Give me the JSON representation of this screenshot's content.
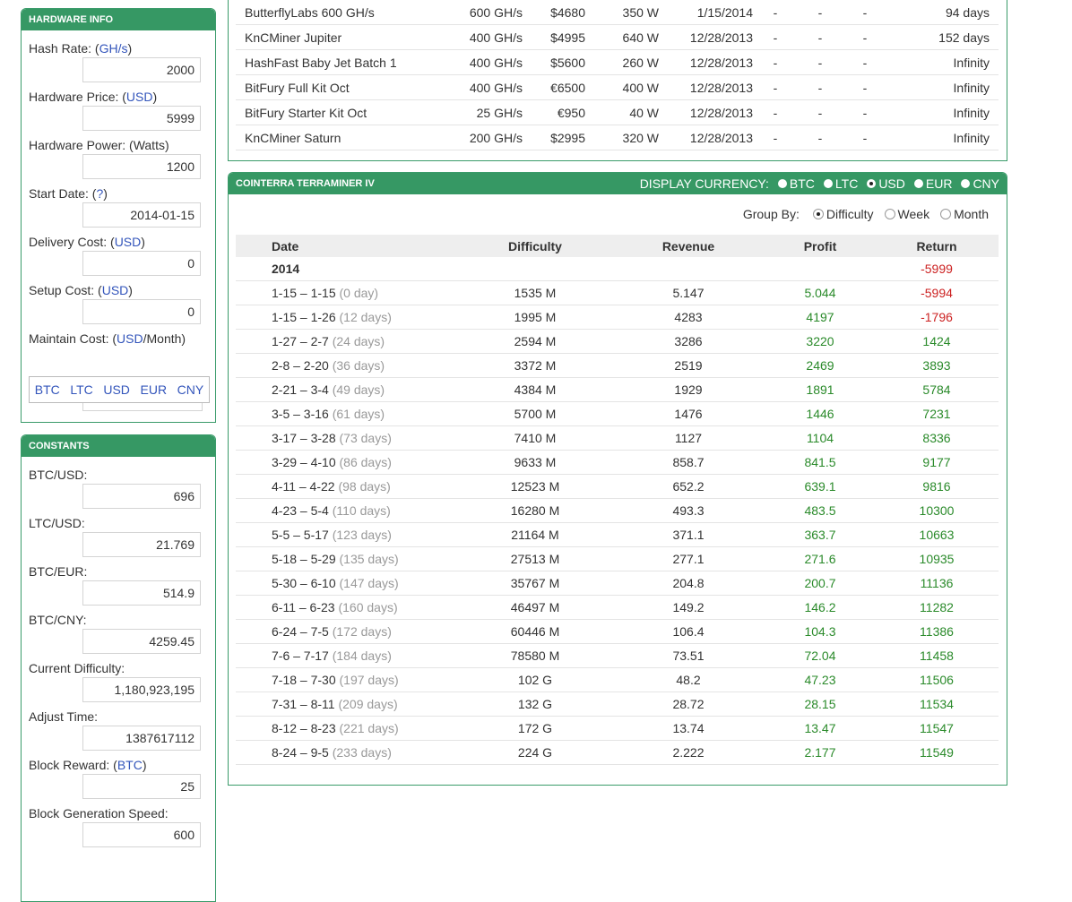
{
  "hardware": {
    "title": "HARDWARE INFO",
    "fields": [
      {
        "label": "Hash Rate: (",
        "link": "GH/s",
        "suffix": ")",
        "value": "2000"
      },
      {
        "label": "Hardware Price: (",
        "link": "USD",
        "suffix": ")",
        "value": "5999"
      },
      {
        "label": "Hardware Power: (Watts)",
        "link": "",
        "suffix": "",
        "value": "1200"
      },
      {
        "label": "Start Date: (",
        "link": "?",
        "suffix": ")",
        "value": "2014-01-15"
      },
      {
        "label": "Delivery Cost: (",
        "link": "USD",
        "suffix": ")",
        "value": "0"
      },
      {
        "label": "Setup Cost: (",
        "link": "USD",
        "suffix": ")",
        "value": "0"
      },
      {
        "label": "Maintain Cost: (",
        "link": "USD",
        "suffix": "/Month)",
        "value": ""
      }
    ],
    "currency_popup": [
      "BTC",
      "LTC",
      "USD",
      "EUR",
      "CNY"
    ]
  },
  "constants": {
    "title": "CONSTANTS",
    "fields": [
      {
        "label": "BTC/USD:",
        "link": "",
        "suffix": "",
        "value": "696"
      },
      {
        "label": "LTC/USD:",
        "link": "",
        "suffix": "",
        "value": "21.769"
      },
      {
        "label": "BTC/EUR:",
        "link": "",
        "suffix": "",
        "value": "514.9"
      },
      {
        "label": "BTC/CNY:",
        "link": "",
        "suffix": "",
        "value": "4259.45"
      },
      {
        "label": "Current Difficulty:",
        "link": "",
        "suffix": "",
        "value": "1,180,923,195"
      },
      {
        "label": "Adjust Time:",
        "link": "",
        "suffix": "",
        "value": "1387617112"
      },
      {
        "label": "Block Reward: (",
        "link": "BTC",
        "suffix": ")",
        "value": "25"
      },
      {
        "label": "Block Generation Speed:",
        "link": "",
        "suffix": "",
        "value": "600"
      }
    ]
  },
  "miners": [
    {
      "name": "ButterflyLabs 600 GH/s",
      "hash": "600 GH/s",
      "price": "$4680",
      "power": "350 W",
      "date": "1/15/2014",
      "a": "-",
      "b": "-",
      "c": "-",
      "ret": "94 days"
    },
    {
      "name": "KnCMiner Jupiter",
      "hash": "400 GH/s",
      "price": "$4995",
      "power": "640 W",
      "date": "12/28/2013",
      "a": "-",
      "b": "-",
      "c": "-",
      "ret": "152 days"
    },
    {
      "name": "HashFast Baby Jet Batch 1",
      "hash": "400 GH/s",
      "price": "$5600",
      "power": "260 W",
      "date": "12/28/2013",
      "a": "-",
      "b": "-",
      "c": "-",
      "ret": "Infinity"
    },
    {
      "name": "BitFury Full Kit Oct",
      "hash": "400 GH/s",
      "price": "€6500",
      "power": "400 W",
      "date": "12/28/2013",
      "a": "-",
      "b": "-",
      "c": "-",
      "ret": "Infinity"
    },
    {
      "name": "BitFury Starter Kit Oct",
      "hash": "25 GH/s",
      "price": "€950",
      "power": "40 W",
      "date": "12/28/2013",
      "a": "-",
      "b": "-",
      "c": "-",
      "ret": "Infinity"
    },
    {
      "name": "KnCMiner Saturn",
      "hash": "200 GH/s",
      "price": "$2995",
      "power": "320 W",
      "date": "12/28/2013",
      "a": "-",
      "b": "-",
      "c": "-",
      "ret": "Infinity"
    }
  ],
  "results": {
    "title": "COINTERRA TERRAMINER IV",
    "display_currency_label": "DISPLAY CURRENCY:",
    "currencies": [
      "BTC",
      "LTC",
      "USD",
      "EUR",
      "CNY"
    ],
    "selected_currency": "USD",
    "group_by_label": "Group By:",
    "group_options": [
      "Difficulty",
      "Week",
      "Month"
    ],
    "selected_group": "Difficulty",
    "headers": [
      "Date",
      "Difficulty",
      "Revenue",
      "Profit",
      "Return"
    ],
    "year_row": {
      "year": "2014",
      "return": "-5999"
    },
    "rows": [
      {
        "date": "1-15 – 1-15",
        "days": "(0 day)",
        "difficulty": "1535 M",
        "revenue": "5.147",
        "profit": "5.044",
        "return": "-5994"
      },
      {
        "date": "1-15 – 1-26",
        "days": "(12 days)",
        "difficulty": "1995 M",
        "revenue": "4283",
        "profit": "4197",
        "return": "-1796"
      },
      {
        "date": "1-27 – 2-7",
        "days": "(24 days)",
        "difficulty": "2594 M",
        "revenue": "3286",
        "profit": "3220",
        "return": "1424"
      },
      {
        "date": "2-8 – 2-20",
        "days": "(36 days)",
        "difficulty": "3372 M",
        "revenue": "2519",
        "profit": "2469",
        "return": "3893"
      },
      {
        "date": "2-21 – 3-4",
        "days": "(49 days)",
        "difficulty": "4384 M",
        "revenue": "1929",
        "profit": "1891",
        "return": "5784"
      },
      {
        "date": "3-5 – 3-16",
        "days": "(61 days)",
        "difficulty": "5700 M",
        "revenue": "1476",
        "profit": "1446",
        "return": "7231"
      },
      {
        "date": "3-17 – 3-28",
        "days": "(73 days)",
        "difficulty": "7410 M",
        "revenue": "1127",
        "profit": "1104",
        "return": "8336"
      },
      {
        "date": "3-29 – 4-10",
        "days": "(86 days)",
        "difficulty": "9633 M",
        "revenue": "858.7",
        "profit": "841.5",
        "return": "9177"
      },
      {
        "date": "4-11 – 4-22",
        "days": "(98 days)",
        "difficulty": "12523 M",
        "revenue": "652.2",
        "profit": "639.1",
        "return": "9816"
      },
      {
        "date": "4-23 – 5-4",
        "days": "(110 days)",
        "difficulty": "16280 M",
        "revenue": "493.3",
        "profit": "483.5",
        "return": "10300"
      },
      {
        "date": "5-5 – 5-17",
        "days": "(123 days)",
        "difficulty": "21164 M",
        "revenue": "371.1",
        "profit": "363.7",
        "return": "10663"
      },
      {
        "date": "5-18 – 5-29",
        "days": "(135 days)",
        "difficulty": "27513 M",
        "revenue": "277.1",
        "profit": "271.6",
        "return": "10935"
      },
      {
        "date": "5-30 – 6-10",
        "days": "(147 days)",
        "difficulty": "35767 M",
        "revenue": "204.8",
        "profit": "200.7",
        "return": "11136"
      },
      {
        "date": "6-11 – 6-23",
        "days": "(160 days)",
        "difficulty": "46497 M",
        "revenue": "149.2",
        "profit": "146.2",
        "return": "11282"
      },
      {
        "date": "6-24 – 7-5",
        "days": "(172 days)",
        "difficulty": "60446 M",
        "revenue": "106.4",
        "profit": "104.3",
        "return": "11386"
      },
      {
        "date": "7-6 – 7-17",
        "days": "(184 days)",
        "difficulty": "78580 M",
        "revenue": "73.51",
        "profit": "72.04",
        "return": "11458"
      },
      {
        "date": "7-18 – 7-30",
        "days": "(197 days)",
        "difficulty": "102 G",
        "revenue": "48.2",
        "profit": "47.23",
        "return": "11506"
      },
      {
        "date": "7-31 – 8-11",
        "days": "(209 days)",
        "difficulty": "132 G",
        "revenue": "28.72",
        "profit": "28.15",
        "return": "11534"
      },
      {
        "date": "8-12 – 8-23",
        "days": "(221 days)",
        "difficulty": "172 G",
        "revenue": "13.74",
        "profit": "13.47",
        "return": "11547"
      },
      {
        "date": "8-24 – 9-5",
        "days": "(233 days)",
        "difficulty": "224 G",
        "revenue": "2.222",
        "profit": "2.177",
        "return": "11549"
      }
    ]
  }
}
